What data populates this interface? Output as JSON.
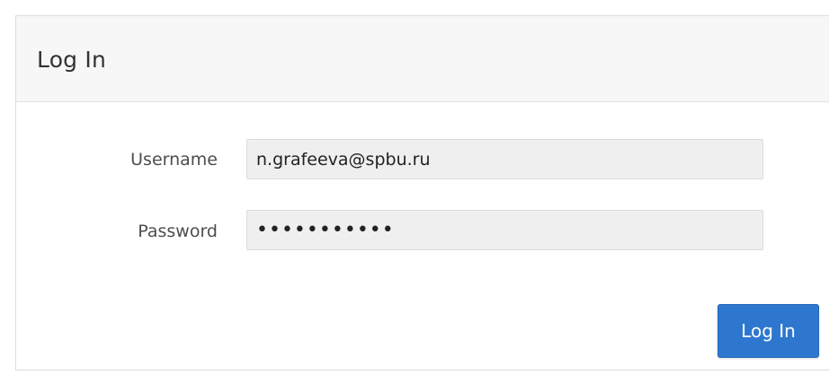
{
  "panel": {
    "title": "Log In"
  },
  "form": {
    "username": {
      "label": "Username",
      "value": "n.grafeeva@spbu.ru"
    },
    "password": {
      "label": "Password",
      "value": "•••••••••••"
    }
  },
  "actions": {
    "login_label": "Log In"
  },
  "colors": {
    "primary_button": "#2d77cf",
    "header_bg": "#f7f7f7",
    "input_bg": "#efefef"
  }
}
